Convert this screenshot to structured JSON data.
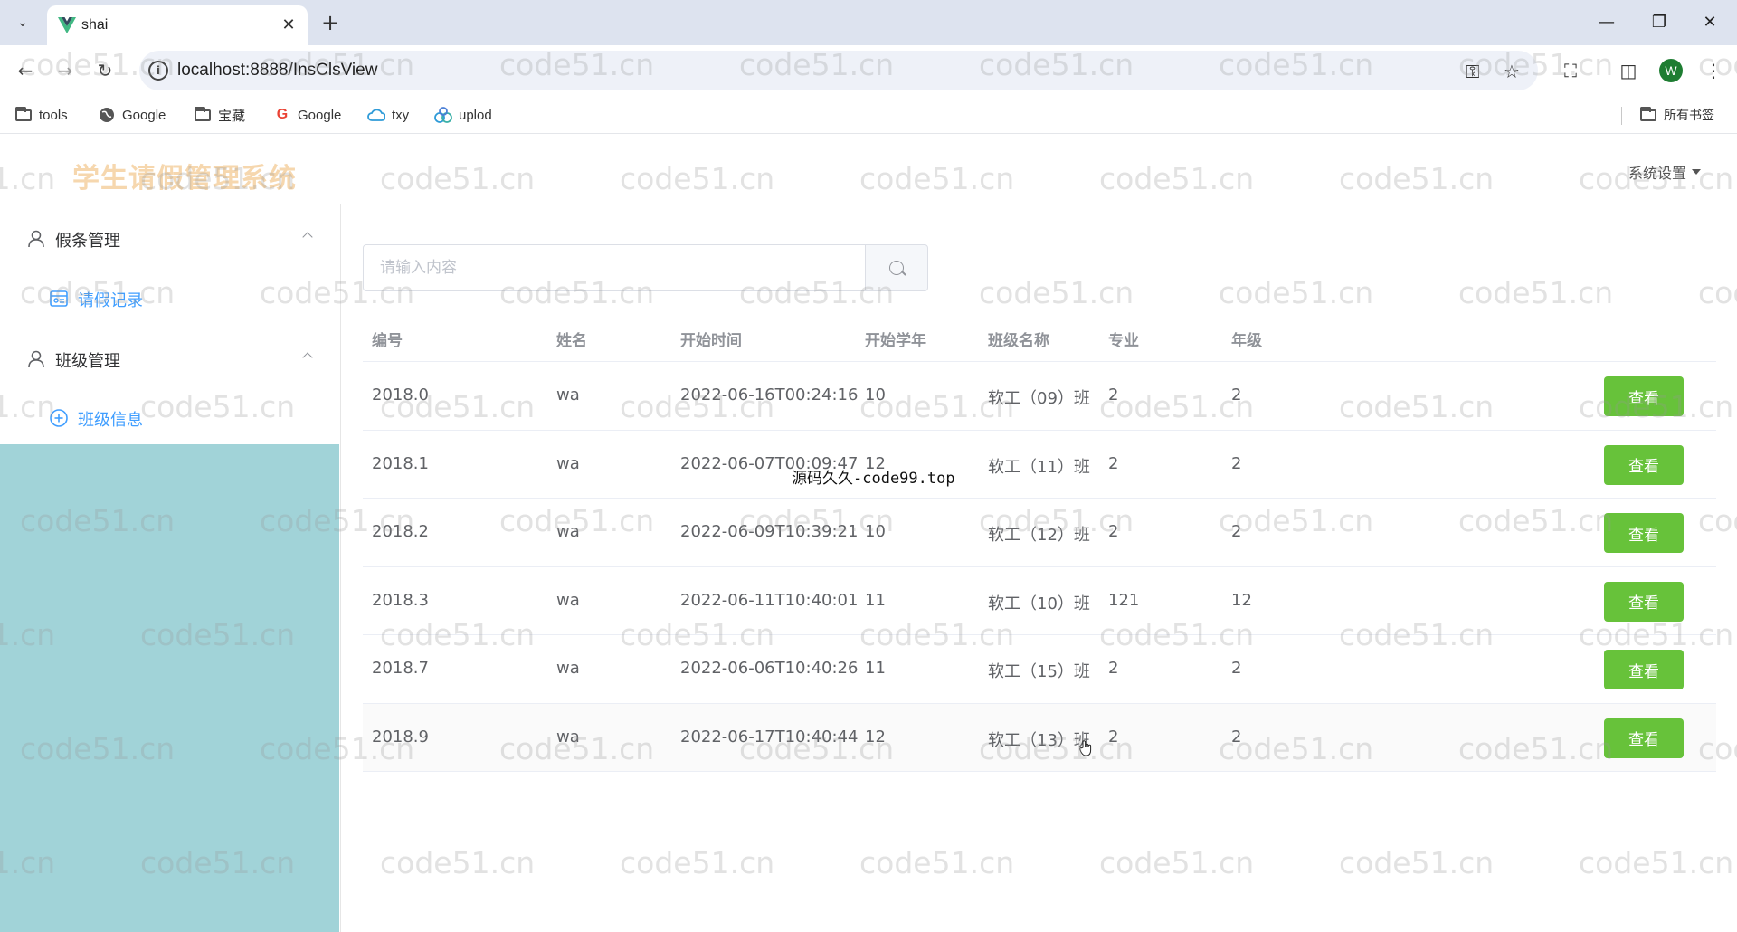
{
  "browser": {
    "tab_title": "shai",
    "url": "localhost:8888/InsClsView",
    "avatar_letter": "W",
    "bookmarks": [
      {
        "label": "tools",
        "icon": "folder-icon"
      },
      {
        "label": "Google",
        "icon": "globe-icon"
      },
      {
        "label": "宝藏",
        "icon": "folder-icon"
      },
      {
        "label": "Google",
        "icon": "google-g-icon"
      },
      {
        "label": "txy",
        "icon": "cloud-icon"
      },
      {
        "label": "uplod",
        "icon": "app-icon"
      }
    ],
    "all_bookmarks_label": "所有书签"
  },
  "app": {
    "title": "学生请假管理系统",
    "settings_label": "系统设置"
  },
  "sidebar": {
    "groups": [
      {
        "label": "假条管理",
        "items": [
          {
            "label": "请假记录",
            "icon": "record-icon"
          }
        ]
      },
      {
        "label": "班级管理",
        "items": [
          {
            "label": "班级信息",
            "icon": "add-circle-icon"
          }
        ]
      }
    ]
  },
  "search": {
    "placeholder": "请输入内容"
  },
  "table": {
    "headers": [
      "编号",
      "姓名",
      "开始时间",
      "开始学年",
      "班级名称",
      "专业",
      "年级"
    ],
    "action_label": "查看",
    "rows": [
      [
        "2018.0",
        "wa",
        "2022-06-16T00:24:16",
        "10",
        "软工（09）班",
        "2",
        "2"
      ],
      [
        "2018.1",
        "wa",
        "2022-06-07T00:09:47",
        "12",
        "软工（11）班",
        "2",
        "2"
      ],
      [
        "2018.2",
        "wa",
        "2022-06-09T10:39:21",
        "10",
        "软工（12）班",
        "2",
        "2"
      ],
      [
        "2018.3",
        "wa",
        "2022-06-11T10:40:01",
        "11",
        "软工（10）班",
        "121",
        "12"
      ],
      [
        "2018.7",
        "wa",
        "2022-06-06T10:40:26",
        "11",
        "软工（15）班",
        "2",
        "2"
      ],
      [
        "2018.9",
        "wa",
        "2022-06-17T10:40:44",
        "12",
        "软工（13）班",
        "2",
        "2"
      ]
    ]
  },
  "overlay_text": "源码久久-code99.top",
  "watermark_text": "code51.cn",
  "colors": {
    "sidebar_bg": "#a1d3d8",
    "menu_active": "#409eff",
    "button_success": "#67c23a",
    "title": "#f6d7ae"
  }
}
